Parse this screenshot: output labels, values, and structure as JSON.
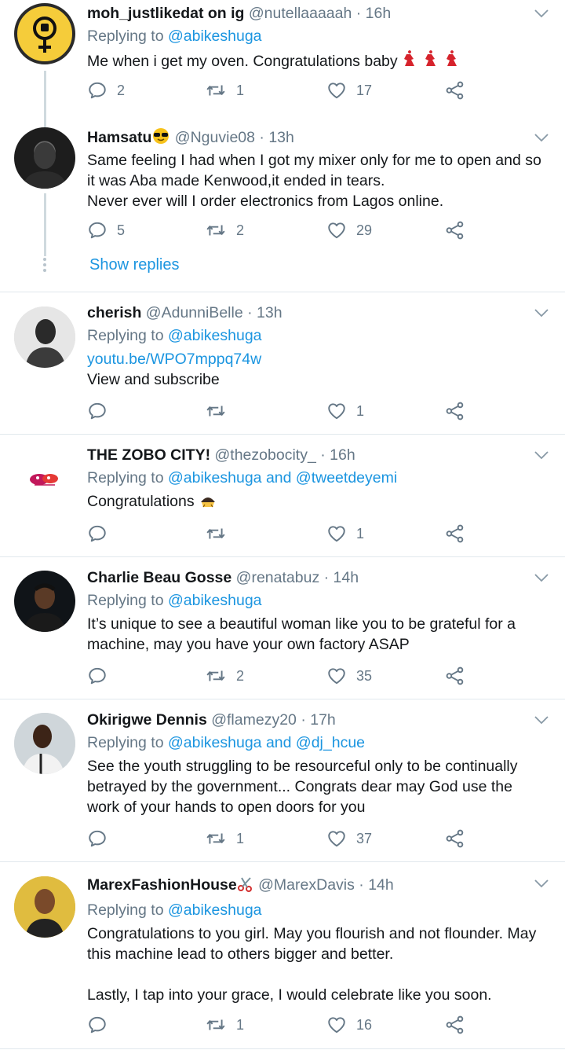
{
  "tweets": [
    {
      "name": "moh_justlikedat on ig",
      "handle": "@nutellaaaaah",
      "time": "· 16h",
      "replying_prefix": "Replying to",
      "replying": "@abikeshuga",
      "body": "Me when i get my oven. Congratulations baby",
      "replies": "2",
      "retweets": "1",
      "likes": "17"
    },
    {
      "name": "Hamsatu",
      "handle": "@Nguvie08",
      "time": "· 13h",
      "body_lines": [
        "Same feeling I had when I got my mixer only for me to open and so",
        "it was Aba made Kenwood,it ended in tears.",
        "Never ever will I order electronics from Lagos online."
      ],
      "replies": "5",
      "retweets": "2",
      "likes": "29",
      "show_replies": "Show replies"
    },
    {
      "name": "cherish",
      "handle": "@AdunniBelle",
      "time": "· 13h",
      "replying_prefix": "Replying to",
      "replying": "@abikeshuga",
      "link": "youtu.be/WPO7mppq74w",
      "body": "View and subscribe",
      "replies": "",
      "retweets": "",
      "likes": "1"
    },
    {
      "name": "THE ZOBO CITY!",
      "handle": "@thezobocity_",
      "time": "· 16h",
      "replying_prefix": "Replying to",
      "replying": "@abikeshuga",
      "replying_and": "and",
      "replying2": "@tweetdeyemi",
      "body": "Congratulations",
      "replies": "",
      "retweets": "",
      "likes": "1"
    },
    {
      "name": "Charlie Beau Gosse",
      "handle": "@renatabuz",
      "time": "· 14h",
      "replying_prefix": "Replying to",
      "replying": "@abikeshuga",
      "body_lines": [
        "It’s unique to see a beautiful woman like  you to be grateful for a",
        "machine, may you have your own factory ASAP"
      ],
      "replies": "",
      "retweets": "2",
      "likes": "35"
    },
    {
      "name": "Okirigwe Dennis",
      "handle": "@flamezy20",
      "time": "· 17h",
      "replying_prefix": "Replying to",
      "replying": "@abikeshuga",
      "replying_and": "and",
      "replying2": "@dj_hcue",
      "body_lines": [
        "See the youth struggling to be resourceful only to be continually",
        "betrayed by the government... Congrats dear may God use the",
        "work of your hands to open doors for you"
      ],
      "replies": "",
      "retweets": "1",
      "likes": "37"
    },
    {
      "name": "MarexFashionHouse",
      "handle": "@MarexDavis",
      "time": "· 14h",
      "replying_prefix": "Replying to",
      "replying": "@abikeshuga",
      "body_lines": [
        "Congratulations to you girl. May you flourish and not flounder. May",
        "this machine lead to others bigger and better.",
        "",
        "Lastly, I tap into your grace, I would celebrate like you soon."
      ],
      "replies": "",
      "retweets": "1",
      "likes": "16"
    }
  ],
  "icons": {
    "reply": "reply-icon",
    "retweet": "retweet-icon",
    "like": "heart-icon",
    "share": "share-icon",
    "more": "chevron-down-icon"
  },
  "colors": {
    "link": "#1b95e0",
    "muted": "#657786",
    "divider": "#e1e8ed"
  }
}
